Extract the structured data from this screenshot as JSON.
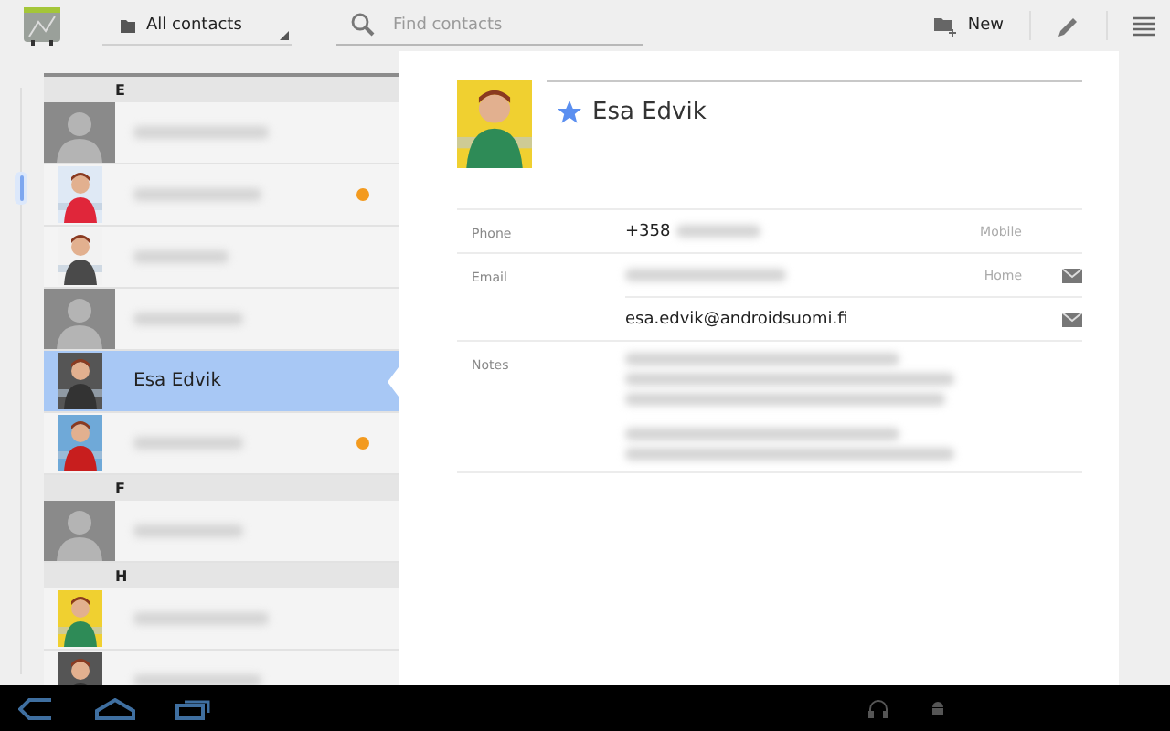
{
  "toolbar": {
    "filter": "All contacts",
    "search": {
      "placeholder": "Find contacts"
    },
    "new_button": "New"
  },
  "contacts": [
    {
      "kind": "header",
      "letter": "E"
    },
    {
      "kind": "contact",
      "photo": false,
      "selected": false,
      "away": false
    },
    {
      "kind": "contact",
      "photo": true,
      "selected": false,
      "away": true
    },
    {
      "kind": "contact",
      "photo": true,
      "selected": false,
      "away": false
    },
    {
      "kind": "contact",
      "photo": false,
      "selected": false,
      "away": false
    },
    {
      "kind": "contact",
      "photo": true,
      "name": "Esa Edvik",
      "selected": true,
      "away": false
    },
    {
      "kind": "contact",
      "photo": true,
      "selected": false,
      "away": true
    },
    {
      "kind": "header",
      "letter": "F"
    },
    {
      "kind": "contact",
      "photo": false,
      "selected": false,
      "away": false
    },
    {
      "kind": "header",
      "letter": "H"
    },
    {
      "kind": "contact",
      "photo": true,
      "selected": false,
      "away": false
    },
    {
      "kind": "contact",
      "photo": true,
      "selected": false,
      "away": false
    }
  ],
  "details": {
    "name": "Esa Edvik",
    "starred": true,
    "sections": [
      {
        "label": "Phone",
        "entries": [
          {
            "kind": "line",
            "value": "+358",
            "redacted": true,
            "type": "Mobile",
            "mail": false
          }
        ]
      },
      {
        "label": "Email",
        "entries": [
          {
            "kind": "line",
            "redacted": true,
            "type": "Home",
            "mail": true
          },
          {
            "kind": "line",
            "value": "esa.edvik@androidsuomi.fi",
            "redacted": false,
            "mail": true
          }
        ]
      },
      {
        "label": "Notes",
        "entries": [
          {
            "kind": "note",
            "redacted": true
          },
          {
            "kind": "note",
            "redacted": true
          }
        ]
      }
    ]
  }
}
